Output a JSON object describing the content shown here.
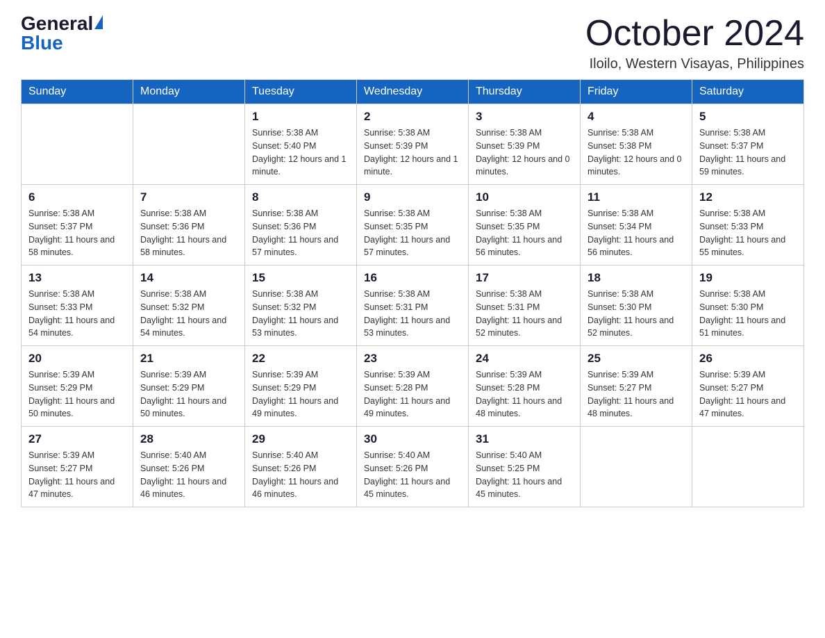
{
  "logo": {
    "general": "General",
    "blue": "Blue"
  },
  "title": {
    "month_year": "October 2024",
    "location": "Iloilo, Western Visayas, Philippines"
  },
  "weekdays": [
    "Sunday",
    "Monday",
    "Tuesday",
    "Wednesday",
    "Thursday",
    "Friday",
    "Saturday"
  ],
  "weeks": [
    [
      {
        "day": "",
        "info": ""
      },
      {
        "day": "",
        "info": ""
      },
      {
        "day": "1",
        "info": "Sunrise: 5:38 AM\nSunset: 5:40 PM\nDaylight: 12 hours and 1 minute."
      },
      {
        "day": "2",
        "info": "Sunrise: 5:38 AM\nSunset: 5:39 PM\nDaylight: 12 hours and 1 minute."
      },
      {
        "day": "3",
        "info": "Sunrise: 5:38 AM\nSunset: 5:39 PM\nDaylight: 12 hours and 0 minutes."
      },
      {
        "day": "4",
        "info": "Sunrise: 5:38 AM\nSunset: 5:38 PM\nDaylight: 12 hours and 0 minutes."
      },
      {
        "day": "5",
        "info": "Sunrise: 5:38 AM\nSunset: 5:37 PM\nDaylight: 11 hours and 59 minutes."
      }
    ],
    [
      {
        "day": "6",
        "info": "Sunrise: 5:38 AM\nSunset: 5:37 PM\nDaylight: 11 hours and 58 minutes."
      },
      {
        "day": "7",
        "info": "Sunrise: 5:38 AM\nSunset: 5:36 PM\nDaylight: 11 hours and 58 minutes."
      },
      {
        "day": "8",
        "info": "Sunrise: 5:38 AM\nSunset: 5:36 PM\nDaylight: 11 hours and 57 minutes."
      },
      {
        "day": "9",
        "info": "Sunrise: 5:38 AM\nSunset: 5:35 PM\nDaylight: 11 hours and 57 minutes."
      },
      {
        "day": "10",
        "info": "Sunrise: 5:38 AM\nSunset: 5:35 PM\nDaylight: 11 hours and 56 minutes."
      },
      {
        "day": "11",
        "info": "Sunrise: 5:38 AM\nSunset: 5:34 PM\nDaylight: 11 hours and 56 minutes."
      },
      {
        "day": "12",
        "info": "Sunrise: 5:38 AM\nSunset: 5:33 PM\nDaylight: 11 hours and 55 minutes."
      }
    ],
    [
      {
        "day": "13",
        "info": "Sunrise: 5:38 AM\nSunset: 5:33 PM\nDaylight: 11 hours and 54 minutes."
      },
      {
        "day": "14",
        "info": "Sunrise: 5:38 AM\nSunset: 5:32 PM\nDaylight: 11 hours and 54 minutes."
      },
      {
        "day": "15",
        "info": "Sunrise: 5:38 AM\nSunset: 5:32 PM\nDaylight: 11 hours and 53 minutes."
      },
      {
        "day": "16",
        "info": "Sunrise: 5:38 AM\nSunset: 5:31 PM\nDaylight: 11 hours and 53 minutes."
      },
      {
        "day": "17",
        "info": "Sunrise: 5:38 AM\nSunset: 5:31 PM\nDaylight: 11 hours and 52 minutes."
      },
      {
        "day": "18",
        "info": "Sunrise: 5:38 AM\nSunset: 5:30 PM\nDaylight: 11 hours and 52 minutes."
      },
      {
        "day": "19",
        "info": "Sunrise: 5:38 AM\nSunset: 5:30 PM\nDaylight: 11 hours and 51 minutes."
      }
    ],
    [
      {
        "day": "20",
        "info": "Sunrise: 5:39 AM\nSunset: 5:29 PM\nDaylight: 11 hours and 50 minutes."
      },
      {
        "day": "21",
        "info": "Sunrise: 5:39 AM\nSunset: 5:29 PM\nDaylight: 11 hours and 50 minutes."
      },
      {
        "day": "22",
        "info": "Sunrise: 5:39 AM\nSunset: 5:29 PM\nDaylight: 11 hours and 49 minutes."
      },
      {
        "day": "23",
        "info": "Sunrise: 5:39 AM\nSunset: 5:28 PM\nDaylight: 11 hours and 49 minutes."
      },
      {
        "day": "24",
        "info": "Sunrise: 5:39 AM\nSunset: 5:28 PM\nDaylight: 11 hours and 48 minutes."
      },
      {
        "day": "25",
        "info": "Sunrise: 5:39 AM\nSunset: 5:27 PM\nDaylight: 11 hours and 48 minutes."
      },
      {
        "day": "26",
        "info": "Sunrise: 5:39 AM\nSunset: 5:27 PM\nDaylight: 11 hours and 47 minutes."
      }
    ],
    [
      {
        "day": "27",
        "info": "Sunrise: 5:39 AM\nSunset: 5:27 PM\nDaylight: 11 hours and 47 minutes."
      },
      {
        "day": "28",
        "info": "Sunrise: 5:40 AM\nSunset: 5:26 PM\nDaylight: 11 hours and 46 minutes."
      },
      {
        "day": "29",
        "info": "Sunrise: 5:40 AM\nSunset: 5:26 PM\nDaylight: 11 hours and 46 minutes."
      },
      {
        "day": "30",
        "info": "Sunrise: 5:40 AM\nSunset: 5:26 PM\nDaylight: 11 hours and 45 minutes."
      },
      {
        "day": "31",
        "info": "Sunrise: 5:40 AM\nSunset: 5:25 PM\nDaylight: 11 hours and 45 minutes."
      },
      {
        "day": "",
        "info": ""
      },
      {
        "day": "",
        "info": ""
      }
    ]
  ]
}
